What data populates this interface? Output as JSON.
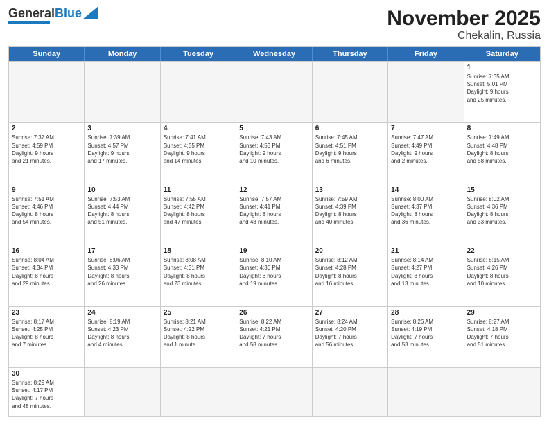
{
  "header": {
    "logo_general": "General",
    "logo_blue": "Blue",
    "title": "November 2025",
    "subtitle": "Chekalin, Russia"
  },
  "weekdays": [
    "Sunday",
    "Monday",
    "Tuesday",
    "Wednesday",
    "Thursday",
    "Friday",
    "Saturday"
  ],
  "rows": [
    [
      {
        "day": "",
        "info": ""
      },
      {
        "day": "",
        "info": ""
      },
      {
        "day": "",
        "info": ""
      },
      {
        "day": "",
        "info": ""
      },
      {
        "day": "",
        "info": ""
      },
      {
        "day": "",
        "info": ""
      },
      {
        "day": "1",
        "info": "Sunrise: 7:35 AM\nSunset: 5:01 PM\nDaylight: 9 hours\nand 25 minutes."
      }
    ],
    [
      {
        "day": "2",
        "info": "Sunrise: 7:37 AM\nSunset: 4:59 PM\nDaylight: 9 hours\nand 21 minutes."
      },
      {
        "day": "3",
        "info": "Sunrise: 7:39 AM\nSunset: 4:57 PM\nDaylight: 9 hours\nand 17 minutes."
      },
      {
        "day": "4",
        "info": "Sunrise: 7:41 AM\nSunset: 4:55 PM\nDaylight: 9 hours\nand 14 minutes."
      },
      {
        "day": "5",
        "info": "Sunrise: 7:43 AM\nSunset: 4:53 PM\nDaylight: 9 hours\nand 10 minutes."
      },
      {
        "day": "6",
        "info": "Sunrise: 7:45 AM\nSunset: 4:51 PM\nDaylight: 9 hours\nand 6 minutes."
      },
      {
        "day": "7",
        "info": "Sunrise: 7:47 AM\nSunset: 4:49 PM\nDaylight: 9 hours\nand 2 minutes."
      },
      {
        "day": "8",
        "info": "Sunrise: 7:49 AM\nSunset: 4:48 PM\nDaylight: 8 hours\nand 58 minutes."
      }
    ],
    [
      {
        "day": "9",
        "info": "Sunrise: 7:51 AM\nSunset: 4:46 PM\nDaylight: 8 hours\nand 54 minutes."
      },
      {
        "day": "10",
        "info": "Sunrise: 7:53 AM\nSunset: 4:44 PM\nDaylight: 8 hours\nand 51 minutes."
      },
      {
        "day": "11",
        "info": "Sunrise: 7:55 AM\nSunset: 4:42 PM\nDaylight: 8 hours\nand 47 minutes."
      },
      {
        "day": "12",
        "info": "Sunrise: 7:57 AM\nSunset: 4:41 PM\nDaylight: 8 hours\nand 43 minutes."
      },
      {
        "day": "13",
        "info": "Sunrise: 7:59 AM\nSunset: 4:39 PM\nDaylight: 8 hours\nand 40 minutes."
      },
      {
        "day": "14",
        "info": "Sunrise: 8:00 AM\nSunset: 4:37 PM\nDaylight: 8 hours\nand 36 minutes."
      },
      {
        "day": "15",
        "info": "Sunrise: 8:02 AM\nSunset: 4:36 PM\nDaylight: 8 hours\nand 33 minutes."
      }
    ],
    [
      {
        "day": "16",
        "info": "Sunrise: 8:04 AM\nSunset: 4:34 PM\nDaylight: 8 hours\nand 29 minutes."
      },
      {
        "day": "17",
        "info": "Sunrise: 8:06 AM\nSunset: 4:33 PM\nDaylight: 8 hours\nand 26 minutes."
      },
      {
        "day": "18",
        "info": "Sunrise: 8:08 AM\nSunset: 4:31 PM\nDaylight: 8 hours\nand 23 minutes."
      },
      {
        "day": "19",
        "info": "Sunrise: 8:10 AM\nSunset: 4:30 PM\nDaylight: 8 hours\nand 19 minutes."
      },
      {
        "day": "20",
        "info": "Sunrise: 8:12 AM\nSunset: 4:28 PM\nDaylight: 8 hours\nand 16 minutes."
      },
      {
        "day": "21",
        "info": "Sunrise: 8:14 AM\nSunset: 4:27 PM\nDaylight: 8 hours\nand 13 minutes."
      },
      {
        "day": "22",
        "info": "Sunrise: 8:15 AM\nSunset: 4:26 PM\nDaylight: 8 hours\nand 10 minutes."
      }
    ],
    [
      {
        "day": "23",
        "info": "Sunrise: 8:17 AM\nSunset: 4:25 PM\nDaylight: 8 hours\nand 7 minutes."
      },
      {
        "day": "24",
        "info": "Sunrise: 8:19 AM\nSunset: 4:23 PM\nDaylight: 8 hours\nand 4 minutes."
      },
      {
        "day": "25",
        "info": "Sunrise: 8:21 AM\nSunset: 4:22 PM\nDaylight: 8 hours\nand 1 minute."
      },
      {
        "day": "26",
        "info": "Sunrise: 8:22 AM\nSunset: 4:21 PM\nDaylight: 7 hours\nand 58 minutes."
      },
      {
        "day": "27",
        "info": "Sunrise: 8:24 AM\nSunset: 4:20 PM\nDaylight: 7 hours\nand 56 minutes."
      },
      {
        "day": "28",
        "info": "Sunrise: 8:26 AM\nSunset: 4:19 PM\nDaylight: 7 hours\nand 53 minutes."
      },
      {
        "day": "29",
        "info": "Sunrise: 8:27 AM\nSunset: 4:18 PM\nDaylight: 7 hours\nand 51 minutes."
      }
    ],
    [
      {
        "day": "30",
        "info": "Sunrise: 8:29 AM\nSunset: 4:17 PM\nDaylight: 7 hours\nand 48 minutes."
      },
      {
        "day": "",
        "info": ""
      },
      {
        "day": "",
        "info": ""
      },
      {
        "day": "",
        "info": ""
      },
      {
        "day": "",
        "info": ""
      },
      {
        "day": "",
        "info": ""
      },
      {
        "day": "",
        "info": ""
      }
    ]
  ]
}
